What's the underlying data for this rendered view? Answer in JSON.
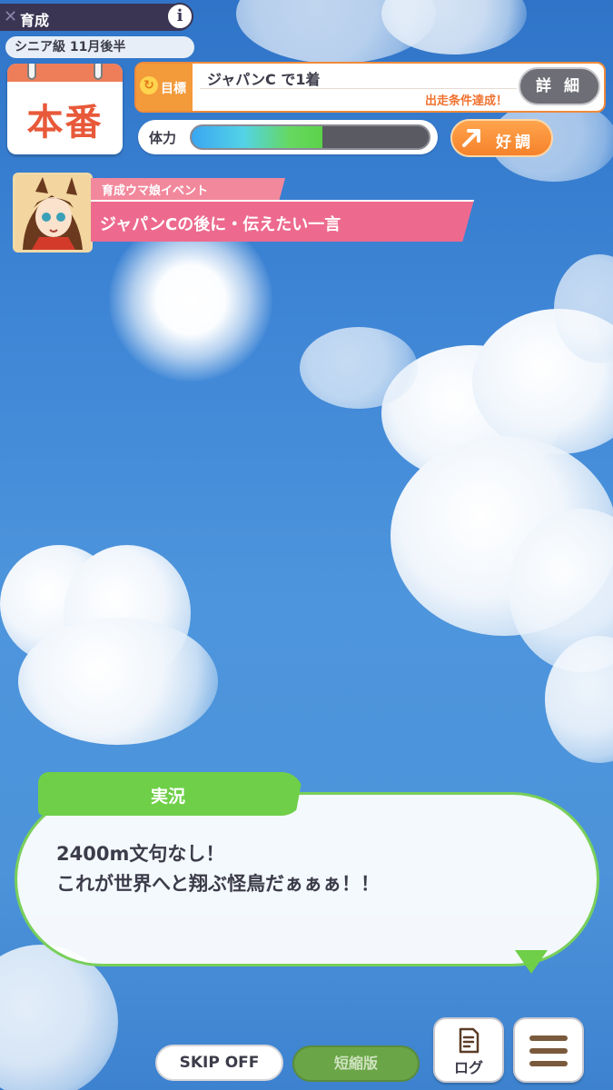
{
  "header": {
    "mode_label": "育成",
    "info_icon": "info-icon",
    "period": "シニア級 11月後半"
  },
  "calendar": {
    "label": "本番"
  },
  "goal": {
    "tag": "目標",
    "title": "ジャパンC で1着",
    "status": "出走条件達成！",
    "detail_button": "詳 細"
  },
  "stamina": {
    "label": "体力",
    "level": 0.55
  },
  "mood": {
    "label": "好調",
    "icon": "arrow-up-right-icon"
  },
  "event": {
    "category": "育成ウマ娘イベント",
    "title": "ジャパンCの後に・伝えたい一言"
  },
  "dialog": {
    "speaker": "実況",
    "line1": "2400m文句なし！",
    "line2": "これが世界へと翔ぶ怪鳥だぁぁぁ！！"
  },
  "controls": {
    "skip": "SKIP OFF",
    "short": "短縮版",
    "log": "ログ",
    "menu_icon": "hamburger-menu-icon"
  },
  "colors": {
    "sky": "#4a90d9",
    "accent_orange": "#f39a3a",
    "event_pink": "#ed6a8e",
    "dialog_green": "#6fcf48"
  }
}
